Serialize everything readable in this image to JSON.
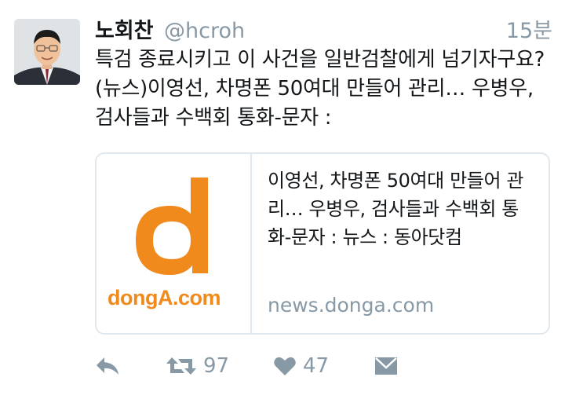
{
  "tweet": {
    "author_name": "노회찬",
    "author_handle": "@hcroh",
    "timestamp": "15분",
    "text": "특검 종료시키고 이 사건을 일반검찰에게 넘기자구요? (뉴스)이영선, 차명폰 50여대 만들어 관리… 우병우, 검사들과 수백회 통화-문자 :"
  },
  "card": {
    "brand": "dongA.com",
    "title": "이영선, 차명폰 50여대 만들어 관리… 우병우, 검사들과 수백회 통화-문자 : 뉴스 : 동아닷컴",
    "domain": "news.donga.com",
    "brand_color": "#f08a1c"
  },
  "actions": {
    "reply_icon": "reply-icon",
    "retweet_icon": "retweet-icon",
    "retweet_count": "97",
    "like_icon": "heart-icon",
    "like_count": "47",
    "dm_icon": "envelope-icon"
  },
  "colors": {
    "text": "#14171a",
    "muted": "#8899a6",
    "border": "#e1e8ed"
  }
}
